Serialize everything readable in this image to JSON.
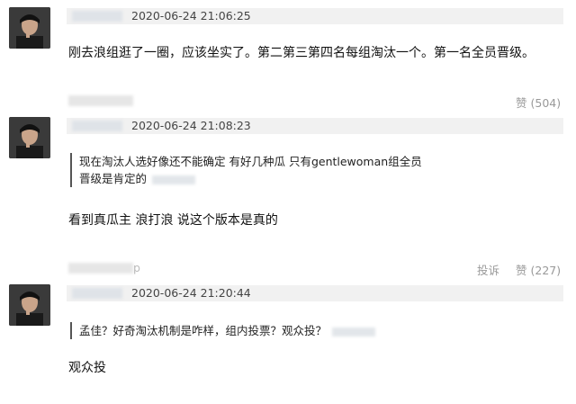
{
  "comments": [
    {
      "timestamp": "2020-06-24 21:06:25",
      "text": "刚去浪组逛了一圈，应该坐实了。第二第三第四名每组淘汰一个。第一名全员晋级。",
      "like_label": "赞",
      "like_count": "(504)"
    },
    {
      "timestamp": "2020-06-24 21:08:23",
      "quote_line1": "现在淘汰人选好像还不能确定 有好几种瓜 只有gentlewoman组全员",
      "quote_line2": "晋级是肯定的",
      "text": "看到真瓜主 浪打浪 说这个版本是真的",
      "footer_tail": "p",
      "report_label": "投诉",
      "like_label": "赞",
      "like_count": "(227)"
    },
    {
      "timestamp": "2020-06-24 21:20:44",
      "quote_line1": "孟佳？好奇淘汰机制是咋样，组内投票？观众投？",
      "text": "观众投"
    }
  ]
}
